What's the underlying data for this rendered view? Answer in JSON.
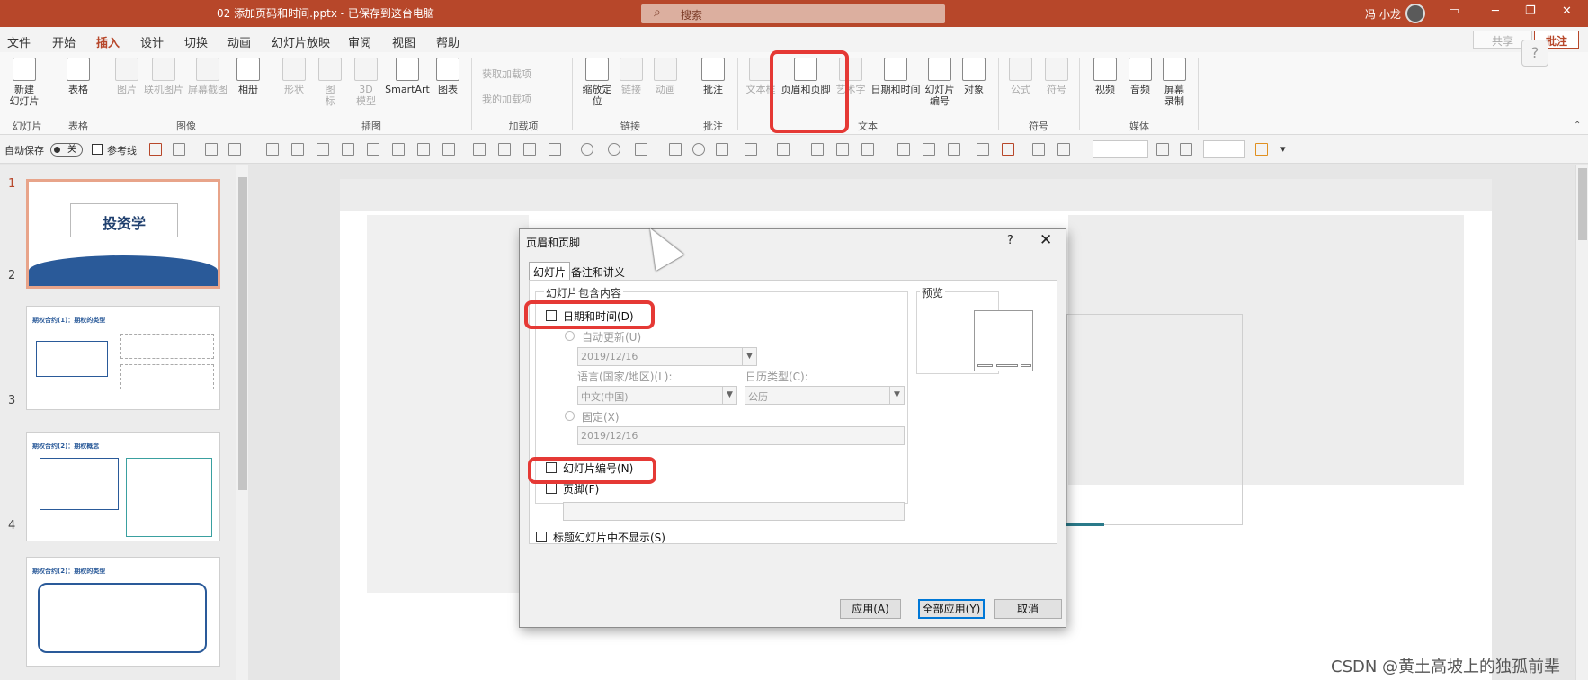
{
  "title_bar": {
    "doc_title": "02 添加页码和时间.pptx - 已保存到这台电脑",
    "search": "搜索",
    "user": "冯 小龙",
    "ribbon_display": "▭",
    "minimize": "─",
    "restore": "❐",
    "close": "✕"
  },
  "menu": {
    "tabs": [
      "文件",
      "开始",
      "插入",
      "设计",
      "切换",
      "动画",
      "幻灯片放映",
      "审阅",
      "视图",
      "帮助"
    ],
    "active": "插入",
    "share": "共享",
    "comments": "批注"
  },
  "ribbon": {
    "new_slide": "新建\n幻灯片",
    "table": "表格",
    "picture": "图片",
    "online_picture": "联机图片",
    "screenshot": "屏幕截图",
    "album": "相册",
    "shapes": "形状",
    "icons": "图\n标",
    "models_3d": "3D\n模型",
    "smartart": "SmartArt",
    "chart": "图表",
    "get_addins": "获取加载项",
    "my_addins": "我的加载项",
    "zoom": "缩放定\n位",
    "link": "链接",
    "action": "动画",
    "comment": "批注",
    "textbox": "文本框",
    "header_footer": "页眉和页脚",
    "wordart": "艺术字",
    "date_time": "日期和时间",
    "slide_number": "幻灯片\n编号",
    "object": "对象",
    "equation": "公式",
    "symbol": "符号",
    "video": "视频",
    "audio": "音频",
    "screen_recording": "屏幕\n录制",
    "groups": {
      "slides": "幻灯片",
      "tables": "表格",
      "images": "图像",
      "illustrations": "插图",
      "addins": "加载项",
      "links": "链接",
      "comments": "批注",
      "text": "文本",
      "symbols": "符号",
      "media": "媒体"
    }
  },
  "qat": {
    "autosave": "自动保存",
    "off": "关",
    "guides": "参考线"
  },
  "slides": [
    {
      "num": "1",
      "title": "投资学"
    },
    {
      "num": "2",
      "title": "期权合约(1)：期权的类型"
    },
    {
      "num": "3",
      "title": "期权合约(2)：期权概念"
    },
    {
      "num": "4",
      "title": "期权合约(2)：期权的类型"
    }
  ],
  "dialog": {
    "title": "页眉和页脚",
    "help": "?",
    "close": "✕",
    "tab_slide": "幻灯片",
    "tab_notes": "备注和讲义",
    "include_legend": "幻灯片包含内容",
    "date_time": "日期和时间(D)",
    "auto_update": "自动更新(U)",
    "auto_date": "2019/12/16",
    "lang_label": "语言(国家/地区)(L):",
    "lang_value": "中文(中国)",
    "calendar_label": "日历类型(C):",
    "calendar_value": "公历",
    "fixed": "固定(X)",
    "fixed_date": "2019/12/16",
    "slide_number": "幻灯片编号(N)",
    "footer": "页脚(F)",
    "dont_show_title": "标题幻灯片中不显示(S)",
    "preview": "预览",
    "apply": "应用(A)",
    "apply_all": "全部应用(Y)",
    "cancel": "取消"
  },
  "watermark": "CSDN @黄土高坡上的独孤前辈",
  "colors": {
    "accent": "#b7472a",
    "highlight": "#e53935",
    "default_btn": "#0078d7"
  }
}
